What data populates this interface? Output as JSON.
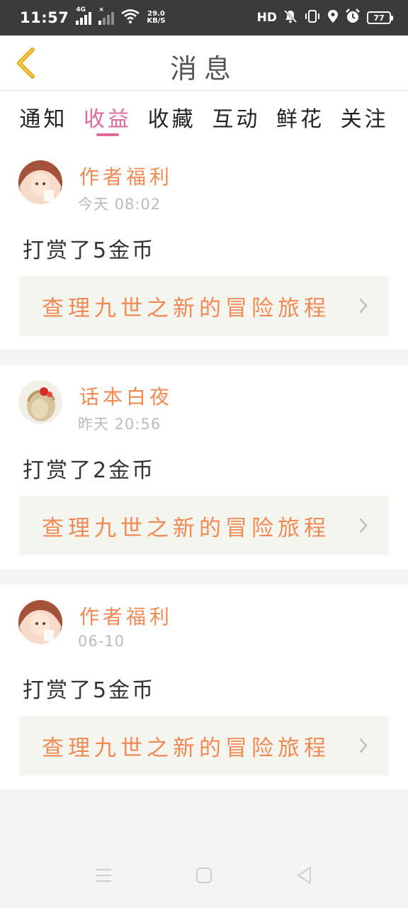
{
  "status_bar": {
    "time": "11:57",
    "network_tag": "4G",
    "sim2_tag": "×",
    "speed_value": "29.0",
    "speed_unit": "KB/S",
    "hd_label": "HD",
    "battery": "77"
  },
  "header": {
    "title": "消息",
    "back_icon": "chevron-left-icon"
  },
  "tabs": [
    {
      "label": "通知",
      "active": false
    },
    {
      "label": "收益",
      "active": true
    },
    {
      "label": "收藏",
      "active": false
    },
    {
      "label": "互动",
      "active": false
    },
    {
      "label": "鲜花",
      "active": false
    },
    {
      "label": "关注",
      "active": false
    }
  ],
  "messages": [
    {
      "sender": "作者福利",
      "time": "今天 08:02",
      "text": "打赏了5金币",
      "book": "查理九世之新的冒险旅程"
    },
    {
      "sender": "话本白夜",
      "time": "昨天 20:56",
      "text": "打赏了2金币",
      "book": "查理九世之新的冒险旅程"
    },
    {
      "sender": "作者福利",
      "time": "06-10",
      "text": "打赏了5金币",
      "book": "查理九世之新的冒险旅程"
    }
  ],
  "colors": {
    "accent_pink": "#e06a9a",
    "accent_orange": "#f08a55",
    "back_icon": "#e0a815"
  },
  "nav": {
    "menu_icon": "menu-icon",
    "home_icon": "home-square-icon",
    "back_icon": "back-triangle-icon"
  }
}
